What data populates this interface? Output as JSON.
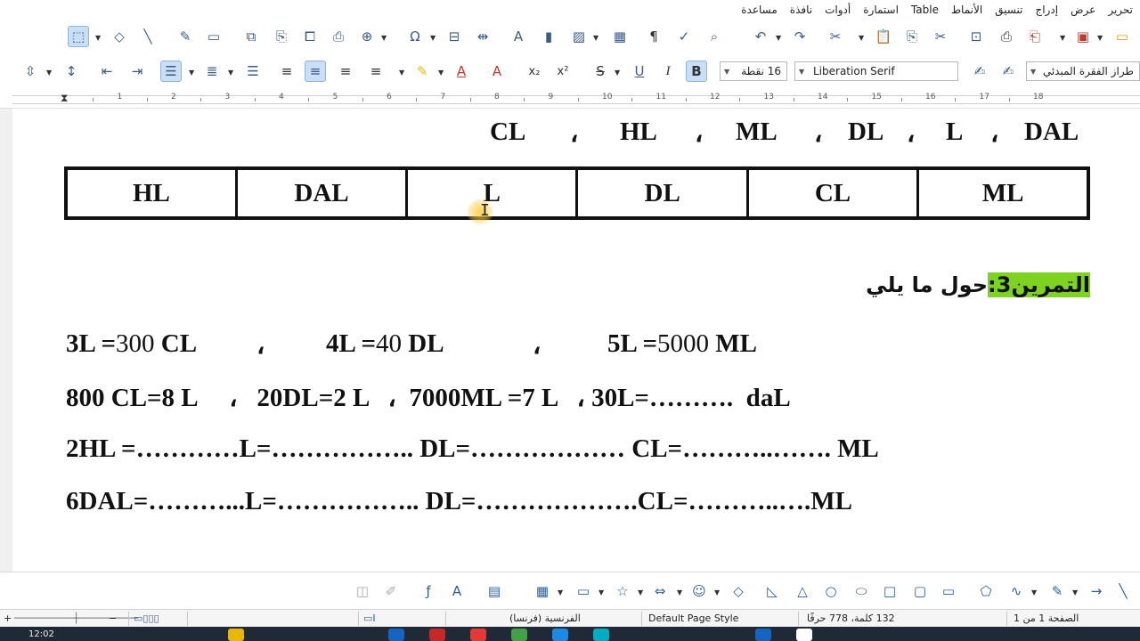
{
  "menu": {
    "items": [
      "تحرير",
      "عرض",
      "إدراج",
      "تنسيق",
      "الأنماط",
      "Table",
      "استمارة",
      "أدوات",
      "نافذة",
      "مساعدة"
    ]
  },
  "format_toolbar": {
    "font_name": "Liberation Serif",
    "font_size": "16 نقطة",
    "paragraph_style": "طراز الفقرة المبدئي"
  },
  "ruler": {
    "numbers": [
      "1",
      "2",
      "3",
      "4",
      "5",
      "6",
      "7",
      "8",
      "9",
      "10",
      "11",
      "12",
      "13",
      "14",
      "15",
      "16",
      "17",
      "18"
    ]
  },
  "document": {
    "units_line": {
      "left": "CL",
      "items": [
        "HL",
        "ML",
        "DL",
        "L",
        "DAL"
      ],
      "separator": "،"
    },
    "table": {
      "cells": [
        "HL",
        "DAL",
        "L",
        "DL",
        "CL",
        "ML"
      ]
    },
    "exercise": {
      "label": "التمرين3:",
      "instruction": "حول ما يلي"
    },
    "row1": {
      "a_lhs": "3L =",
      "a_val": "300",
      "a_unit": " CL",
      "b_lhs": "4L =",
      "b_val": "40",
      "b_unit": " DL",
      "c_lhs": "5L =",
      "c_val": "5000",
      "c_unit": " ML",
      "sep": "،"
    },
    "row2": "800 CL=8 L     ،   20DL=2 L   ،  7000ML =7 L   ، 30L=……….  daL",
    "row3": "2HL =…………L=…………….. DL=……………… CL=………..……. ML",
    "row4": "6DAL=………...L=…………….. DL=……………….CL=………..….ML"
  },
  "status": {
    "page": "الصفحة 1 من 1",
    "words": "132 كلمة، 778 حرفًا",
    "page_style": "Default Page Style",
    "language": "الفرنسية (فرنسا)"
  },
  "taskbar": {
    "time": "12:02"
  }
}
